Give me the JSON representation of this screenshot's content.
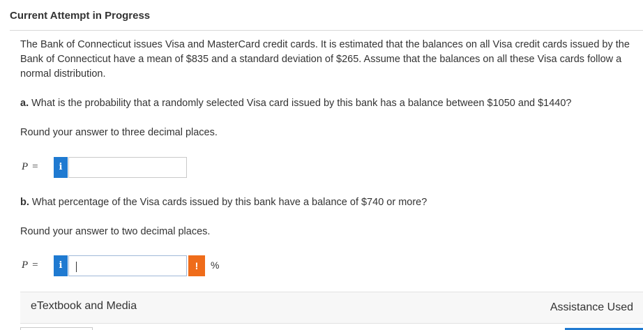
{
  "status": "Current Attempt in Progress",
  "intro": "The Bank of Connecticut issues Visa and MasterCard credit cards. It is estimated that the balances on all Visa credit cards issued by the Bank of Connecticut have a mean of $835 and a standard deviation of $265. Assume that the balances on all these Visa cards follow a normal distribution.",
  "part_a": {
    "prefix": "a.",
    "question": " What is the probability that a randomly selected Visa card issued by this bank has a balance between $1050 and $1440?",
    "hint": "Round your answer to three decimal places.",
    "label": "P",
    "equals": "=",
    "info_icon": "i",
    "value": ""
  },
  "part_b": {
    "prefix": "b.",
    "question": " What percentage of the Visa cards issued by this bank have a balance of $740 or more?",
    "hint": "Round your answer to two decimal places.",
    "label": "P",
    "equals": "=",
    "info_icon": "i",
    "warn_icon": "!",
    "value": "",
    "unit": "%"
  },
  "footer": {
    "etextbook": "eTextbook and Media",
    "assistance": "Assistance Used"
  },
  "colors": {
    "accent": "#1f7ad1",
    "warning": "#ef6c1a"
  }
}
